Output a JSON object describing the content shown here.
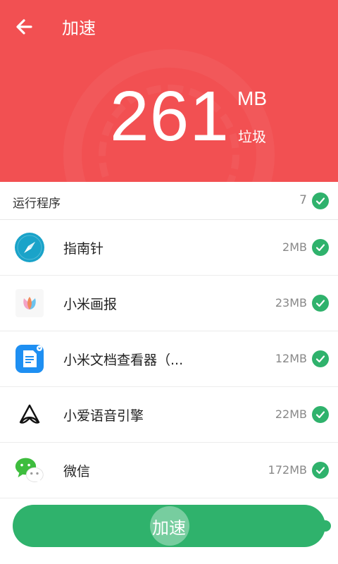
{
  "header": {
    "title": "加速",
    "amount": "261",
    "unit": "MB",
    "unit_label": "垃圾",
    "background": "#f25052"
  },
  "section": {
    "label": "运行程序",
    "count": "7"
  },
  "apps": [
    {
      "name": "指南针",
      "size": "2MB",
      "icon": "compass-icon"
    },
    {
      "name": "小米画报",
      "size": "23MB",
      "icon": "tulip-icon"
    },
    {
      "name": "小米文档查看器（...",
      "size": "12MB",
      "icon": "document-icon"
    },
    {
      "name": "小爱语音引擎",
      "size": "22MB",
      "icon": "xiaoai-icon"
    },
    {
      "name": "微信",
      "size": "172MB",
      "icon": "wechat-icon"
    }
  ],
  "action": {
    "label": "加速",
    "accent": "#2fb26c"
  }
}
